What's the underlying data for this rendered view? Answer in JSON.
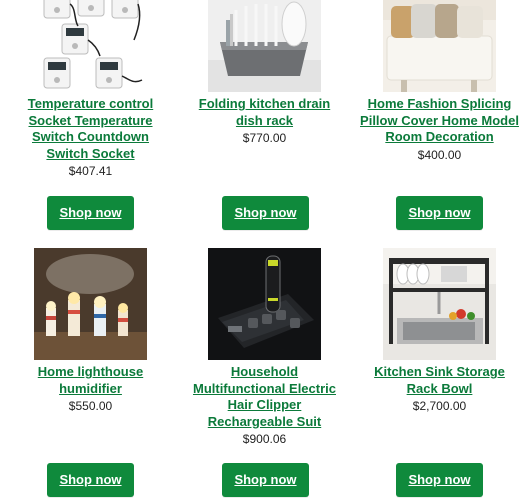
{
  "colors": {
    "link": "#0b7a3a",
    "button_bg": "#0f8a3c",
    "button_text": "#ffffff",
    "price_text": "#222222"
  },
  "products": [
    {
      "name": "Temperature control Socket Temperature Switch Countdown Switch Socket",
      "price": "$407.41",
      "button": "Shop now",
      "image": "temperature-sockets-image"
    },
    {
      "name": "Folding kitchen drain dish rack",
      "price": "$770.00",
      "button": "Shop now",
      "image": "dish-rack-image"
    },
    {
      "name": "Home Fashion Splicing Pillow Cover Home Model Room Decoration",
      "price": "$400.00",
      "button": "Shop now",
      "image": "pillow-sofa-image"
    },
    {
      "name": "Home lighthouse humidifier",
      "price": "$550.00",
      "button": "Shop now",
      "image": "lighthouse-humidifier-image"
    },
    {
      "name": "Household Multifunctional Electric Hair Clipper Rechargeable Suit",
      "price": "$900.06",
      "button": "Shop now",
      "image": "hair-clipper-image"
    },
    {
      "name": "Kitchen Sink Storage Rack Bowl",
      "price": "$2,700.00",
      "button": "Shop now",
      "image": "sink-rack-image"
    }
  ]
}
